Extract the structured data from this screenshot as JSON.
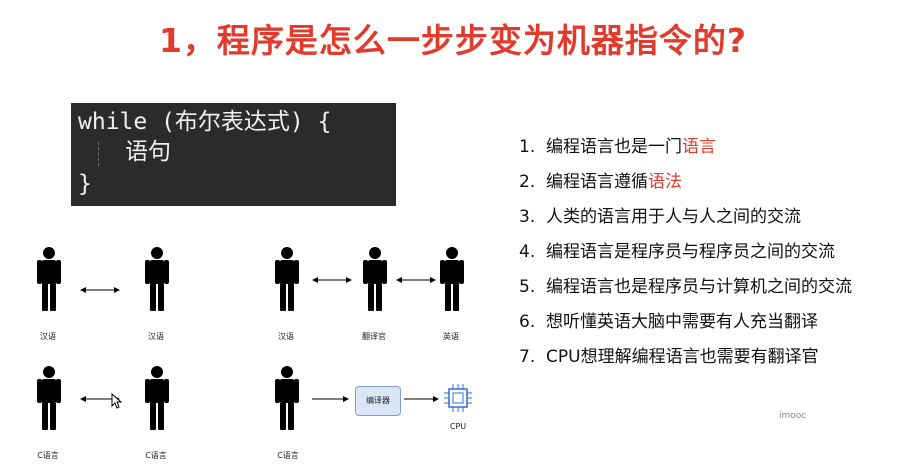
{
  "title": "1，程序是怎么一步步变为机器指令的?",
  "code": {
    "line1": "while (布尔表达式) {",
    "line2": "语句",
    "line3": "}"
  },
  "list": [
    {
      "num": "1.",
      "text": "编程语言也是一门",
      "highlight": "语言"
    },
    {
      "num": "2.",
      "text": "编程语言遵循",
      "highlight": "语法"
    },
    {
      "num": "3.",
      "text": "人类的语言用于人与人之间的交流"
    },
    {
      "num": "4.",
      "text": "编程语言是程序员与程序员之间的交流"
    },
    {
      "num": "5.",
      "text": "编程语言也是程序员与计算机之间的交流"
    },
    {
      "num": "6.",
      "text": "想听懂英语大脑中需要有人充当翻译"
    },
    {
      "num": "7.",
      "text": "CPU想理解编程语言也需要有翻译官"
    }
  ],
  "diagram": {
    "labels": {
      "hanyu": "汉语",
      "fanyiguan": "翻译官",
      "yingyu": "英语",
      "c_lang": "C语言",
      "compiler": "编译器",
      "cpu": "CPU"
    }
  },
  "watermark": "imooc",
  "colors": {
    "accent": "#e23b2e",
    "code_bg": "#2b2b2b"
  }
}
